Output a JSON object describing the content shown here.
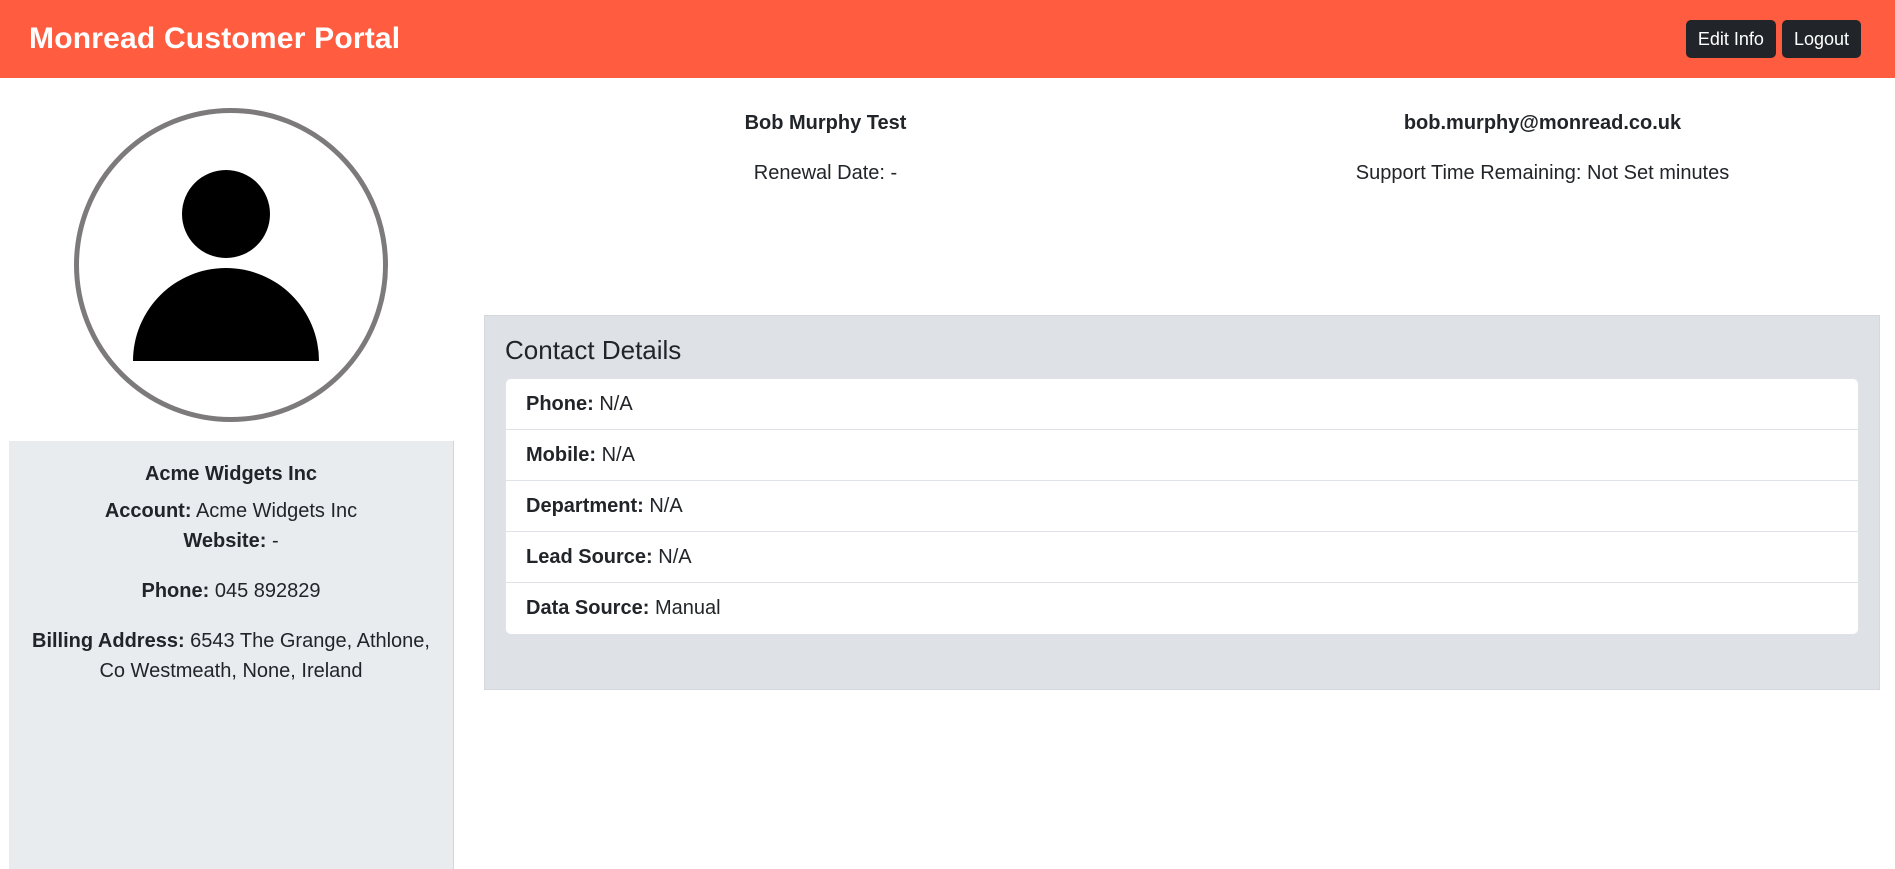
{
  "app": {
    "title": "Monread Customer Portal"
  },
  "nav": {
    "edit_label": "Edit Info",
    "logout_label": "Logout"
  },
  "profile": {
    "name": "Bob Murphy Test",
    "email": "bob.murphy@monread.co.uk",
    "renewal_text": "Renewal Date: -",
    "support_text": "Support Time Remaining: Not Set minutes",
    "avatar_icon": "user-silhouette-icon"
  },
  "account": {
    "name": "Acme Widgets Inc",
    "account_label": "Account:",
    "account_value": "Acme Widgets Inc",
    "website_label": "Website:",
    "website_value": "-",
    "phone_label": "Phone:",
    "phone_value": "045 892829",
    "billing_label": "Billing Address:",
    "billing_value": "6543 The Grange, Athlone, Co Westmeath, None, Ireland"
  },
  "contact": {
    "title": "Contact Details",
    "items": [
      {
        "label": "Phone:",
        "value": "N/A"
      },
      {
        "label": "Mobile:",
        "value": "N/A"
      },
      {
        "label": "Department:",
        "value": "N/A"
      },
      {
        "label": "Lead Source:",
        "value": "N/A"
      },
      {
        "label": "Data Source:",
        "value": "Manual"
      }
    ]
  },
  "colors": {
    "brand": "#ff5c40",
    "button_dark": "#212529",
    "panel_bg": "#e9ecef",
    "contact_bg": "#dee1e5"
  }
}
